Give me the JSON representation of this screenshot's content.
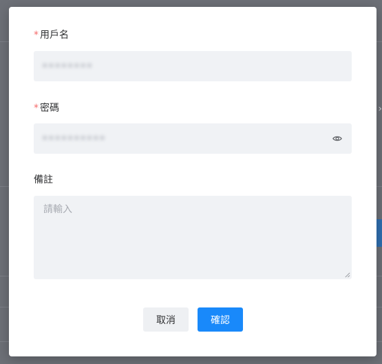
{
  "dialog": {
    "username": {
      "label": "用戶名",
      "required_mark": "*",
      "value": "••••••••"
    },
    "password": {
      "label": "密碼",
      "required_mark": "*",
      "value": "••••••••••"
    },
    "remark": {
      "label": "備註",
      "placeholder": "請輸入"
    },
    "buttons": {
      "cancel": "取消",
      "confirm": "確認"
    }
  },
  "colors": {
    "accent": "#1989fa",
    "required": "#f56c6c",
    "input_bg": "#f0f2f5"
  },
  "icons": {
    "password_toggle": "eye-icon"
  }
}
